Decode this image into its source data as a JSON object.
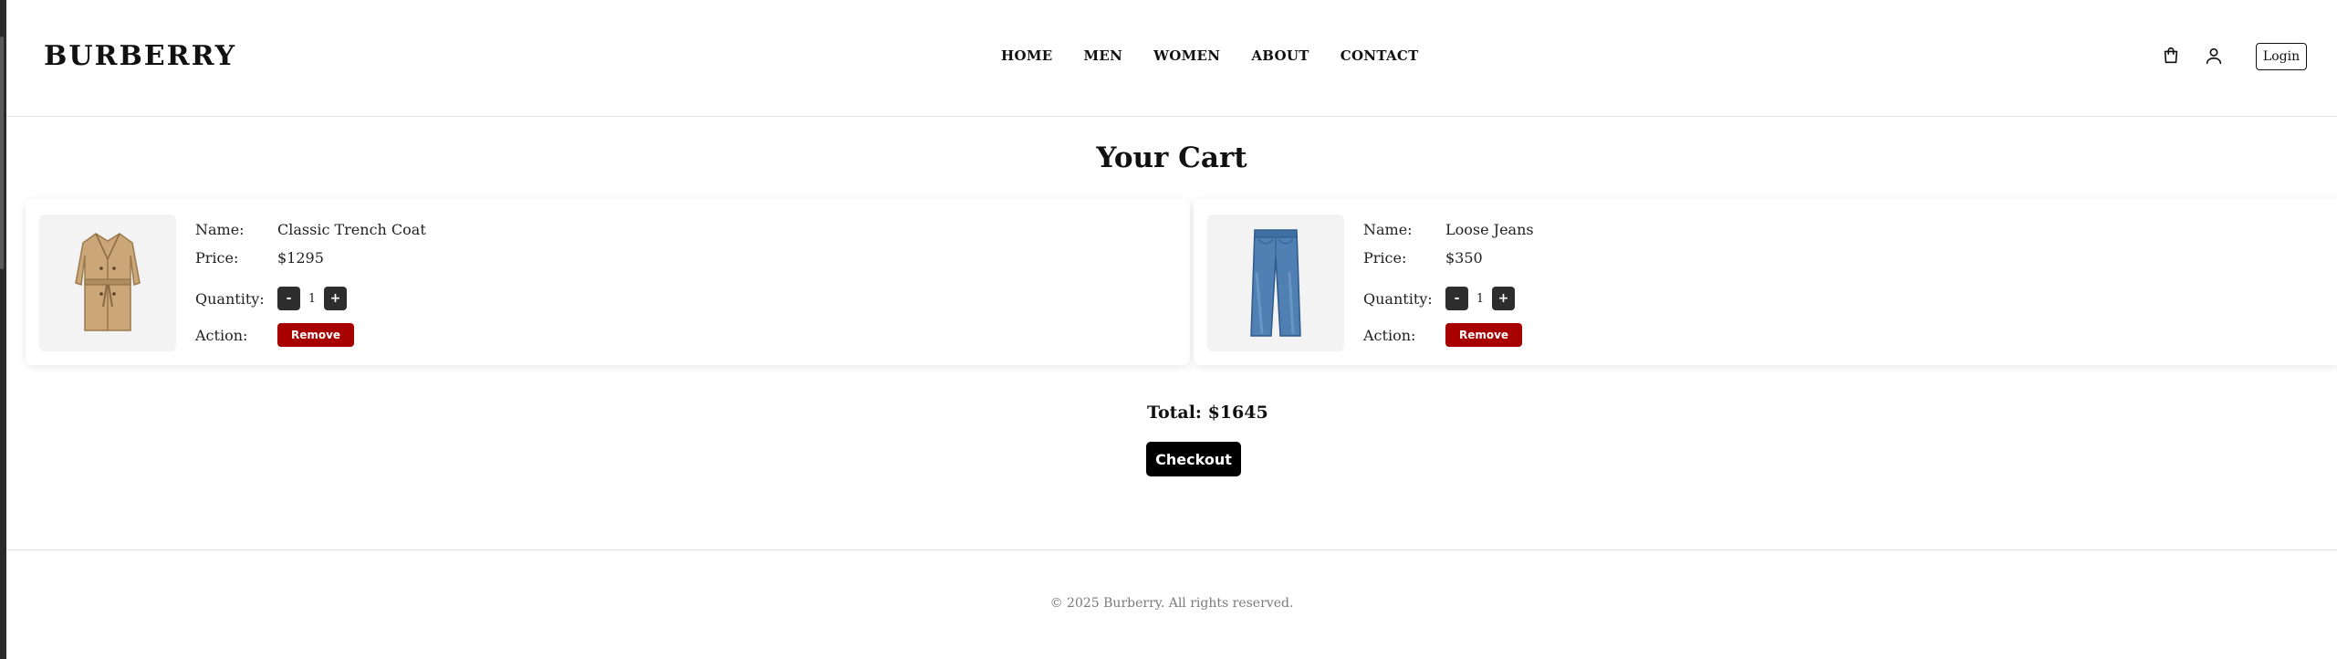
{
  "brand": {
    "name": "BURBERRY"
  },
  "nav": {
    "links": [
      "HOME",
      "MEN",
      "WOMEN",
      "ABOUT",
      "CONTACT"
    ],
    "login_label": "Login",
    "icons": [
      "cart-icon",
      "user-icon"
    ]
  },
  "cart": {
    "title": "Your Cart",
    "field_labels": {
      "name": "Name:",
      "price": "Price:",
      "quantity": "Quantity:",
      "action": "Action:"
    },
    "decrement_label": "-",
    "increment_label": "+",
    "remove_label": "Remove",
    "items": [
      {
        "name": "Classic Trench Coat",
        "price": "$1295",
        "quantity": "1",
        "image": "trench-coat-image"
      },
      {
        "name": "Loose Jeans",
        "price": "$350",
        "quantity": "1",
        "image": "jeans-image"
      }
    ],
    "total": "Total: $1645",
    "checkout_label": "Checkout"
  },
  "footer": {
    "text": "© 2025 Burberry. All rights reserved."
  },
  "colors": {
    "remove": "#a80000",
    "checkout": "#000000",
    "qty_button": "#2d2d2d",
    "page_bg": "#ffffff"
  }
}
